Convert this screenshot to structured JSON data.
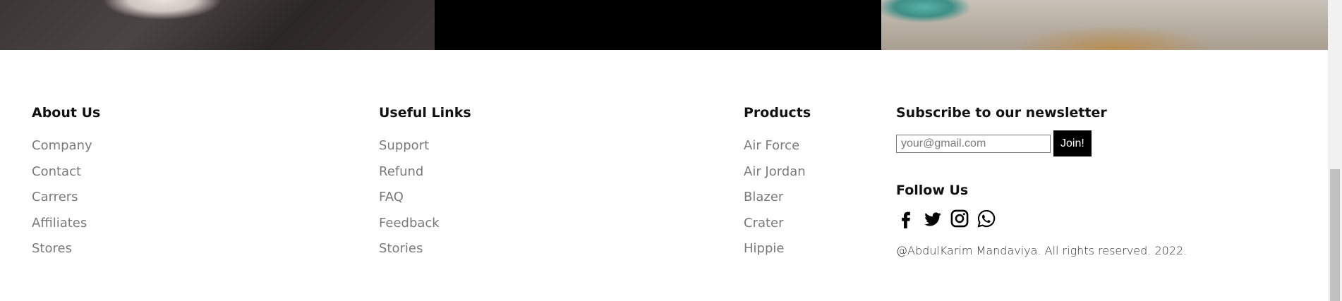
{
  "columns": [
    {
      "heading": "About Us",
      "links": [
        "Company",
        "Contact",
        "Carrers",
        "Affiliates",
        "Stores"
      ]
    },
    {
      "heading": "Useful Links",
      "links": [
        "Support",
        "Refund",
        "FAQ",
        "Feedback",
        "Stories"
      ]
    },
    {
      "heading": "Products",
      "links": [
        "Air Force",
        "Air Jordan",
        "Blazer",
        "Crater",
        "Hippie"
      ]
    }
  ],
  "newsletter": {
    "heading": "Subscribe to our newsletter",
    "placeholder": "your@gmail.com",
    "button_label": "Join!"
  },
  "follow": {
    "heading": "Follow Us",
    "icons": [
      "facebook-icon",
      "twitter-icon",
      "instagram-icon",
      "whatsapp-icon"
    ]
  },
  "copyright": "@AbdulKarim Mandaviya. All rights reserved. 2022."
}
